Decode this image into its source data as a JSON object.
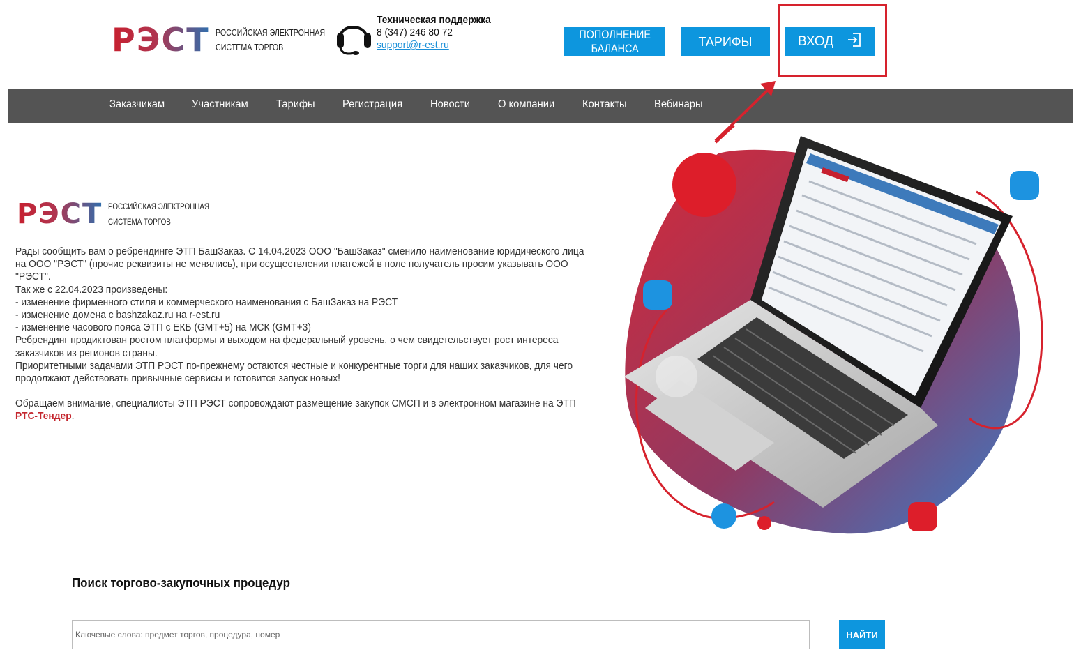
{
  "header": {
    "logo": {
      "mark": "РЭСТ",
      "line1": "РОССИЙСКАЯ ЭЛЕКТРОННАЯ",
      "line2": "СИСТЕМА ТОРГОВ"
    },
    "support": {
      "icon": "headset-icon",
      "title": "Техническая поддержка",
      "phone": "8 (347) 246 80 72",
      "email": "support@r-est.ru"
    },
    "buttons": {
      "balance_line1": "ПОПОЛНЕНИЕ",
      "balance_line2": "БАЛАНСА",
      "tariffs": "ТАРИФЫ",
      "login": "ВХОД",
      "login_icon": "login-icon"
    }
  },
  "nav": {
    "items": [
      "Заказчикам",
      "Участникам",
      "Тарифы",
      "Регистрация",
      "Новости",
      "О компании",
      "Контакты",
      "Вебинары"
    ]
  },
  "hero": {
    "logo": {
      "mark": "РЭСТ",
      "line1": "РОССИЙСКАЯ ЭЛЕКТРОННАЯ",
      "line2": "СИСТЕМА ТОРГОВ"
    },
    "lines": [
      "Рады сообщить вам о ребрендинге ЭТП БашЗаказ. С 14.04.2023 ООО \"БашЗаказ\" сменило наименование юридического лица",
      "на ООО \"РЭСТ\" (прочие реквизиты не менялись), при осуществлении платежей в поле получатель просим указывать ООО",
      "\"РЭСТ\".",
      "Так же с 22.04.2023 произведены:",
      "- изменение фирменного стиля и коммерческого наименования с БашЗаказ на РЭСТ",
      "- изменение домена с bashzakaz.ru на r-est.ru",
      "- изменение часового пояса ЭТП с ЕКБ (GMT+5) на МСК (GMT+3)",
      "Ребрендинг продиктован ростом платформы и выходом на федеральный уровень, о чем свидетельствует рост интереса",
      "заказчиков из регионов страны.",
      "Приоритетными задачами ЭТП РЭСТ по-прежнему остаются честные и конкурентные торги для наших заказчиков, для чего",
      "продолжают действовать привычные сервисы и готовится запуск новых!"
    ],
    "notice": "Обращаем внимание, специалисты ЭТП РЭСТ сопровождают размещение закупок СМСП и в электронном магазине на ЭТП",
    "notice_link": "РТС-Тендер",
    "notice_end": ".",
    "illustration": "laptop-illustration"
  },
  "search": {
    "title": "Поиск торгово-закупочных процедур",
    "placeholder": "Ключевые слова: предмет торгов, процедура, номер",
    "value": "",
    "button": "НАЙТИ"
  },
  "colors": {
    "accent": "#0d96de",
    "nav_bg": "#545454",
    "brand_red": "#c7202f",
    "highlight": "#d6222d"
  }
}
